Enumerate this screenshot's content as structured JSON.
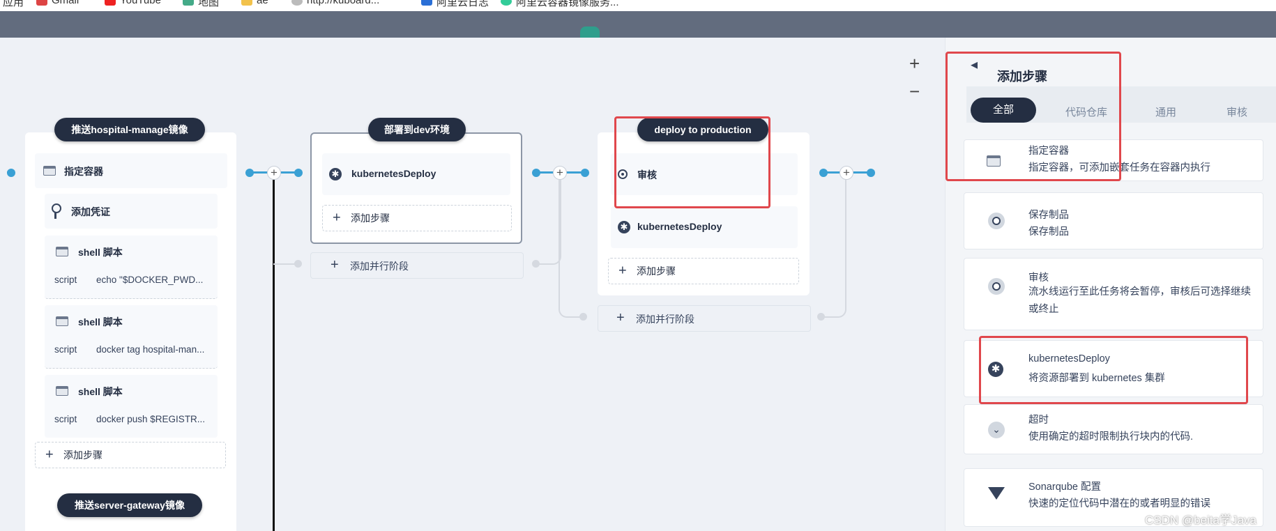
{
  "browser": {
    "bookmarks": [
      "应用",
      "Gmail",
      "YouTube",
      "地图",
      "ae",
      "http://kuboard...",
      "阿里云日志",
      "阿里云容器镜像服务..."
    ]
  },
  "canvas": {
    "zoom_in": "+",
    "zoom_out": "−",
    "add_step_label": "添加步骤",
    "add_parallel_label": "添加并行阶段",
    "stages": [
      {
        "title": "推送hospital-manage镜像",
        "steps": [
          {
            "title": "指定容器",
            "icon": "terminal-icon"
          },
          {
            "title": "添加凭证",
            "icon": "key-icon"
          },
          {
            "title": "shell 脚本",
            "icon": "terminal-icon",
            "script_label": "script",
            "script": "echo \"$DOCKER_PWD..."
          },
          {
            "title": "shell 脚本",
            "icon": "terminal-icon",
            "script_label": "script",
            "script": "docker tag hospital-man..."
          },
          {
            "title": "shell 脚本",
            "icon": "terminal-icon",
            "script_label": "script",
            "script": "docker push $REGISTR..."
          }
        ]
      },
      {
        "title": "部署到dev环境",
        "steps": [
          {
            "title": "kubernetesDeploy",
            "icon": "kubernetes-icon"
          }
        ]
      },
      {
        "title": "deploy to production",
        "steps": [
          {
            "title": "审核",
            "icon": "review-icon"
          },
          {
            "title": "kubernetesDeploy",
            "icon": "kubernetes-icon"
          }
        ]
      },
      {
        "title": "推送server-gateway镜像",
        "steps": []
      }
    ]
  },
  "panel": {
    "title": "添加步骤",
    "back_icon": "back-arrow-icon",
    "tabs": [
      "全部",
      "代码仓库",
      "通用",
      "审核"
    ],
    "active_tab": "全部",
    "tasks": [
      {
        "name": "指定容器",
        "desc": "指定容器，可添加嵌套任务在容器内执行",
        "icon": "terminal-icon"
      },
      {
        "name": "保存制品",
        "desc": "保存制品",
        "icon": "artifact-icon"
      },
      {
        "name": "审核",
        "desc": "流水线运行至此任务将会暂停，审核后可选择继续或终止",
        "icon": "review-icon"
      },
      {
        "name": "kubernetesDeploy",
        "desc": "将资源部署到 kubernetes 集群",
        "icon": "kubernetes-icon"
      },
      {
        "name": "超时",
        "desc": "使用确定的超时限制执行块内的代码.",
        "icon": "timeout-icon"
      },
      {
        "name": "Sonarqube 配置",
        "desc": "快速的定位代码中潜在的或者明显的错误",
        "icon": "sonarqube-icon"
      }
    ]
  },
  "watermark": "CSDN @beita学Java",
  "colors": {
    "accent": "#3aa0d4",
    "dark": "#242e42",
    "highlight": "#e0474c",
    "topbar": "#626c7e"
  }
}
